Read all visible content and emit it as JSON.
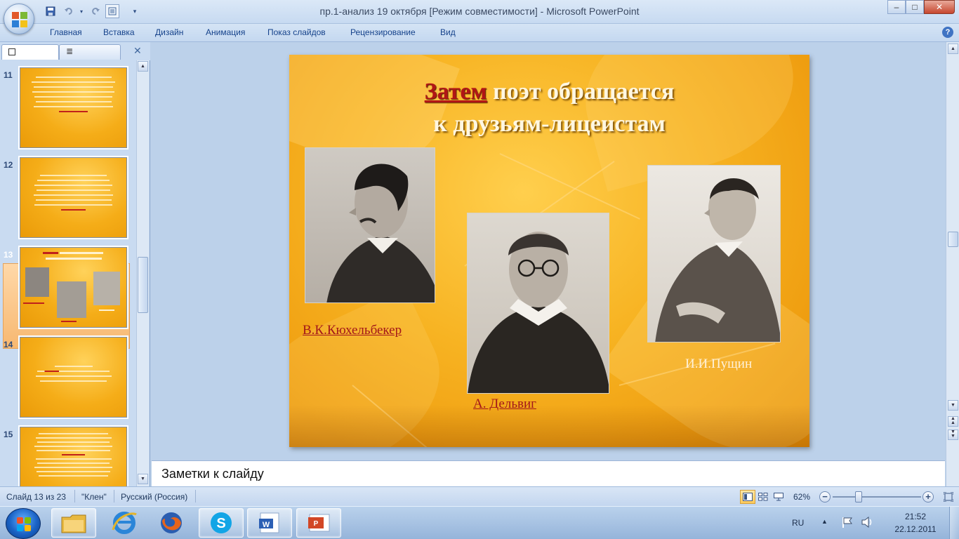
{
  "window": {
    "title": "пр.1-анализ 19 октября [Режим совместимости] - Microsoft PowerPoint",
    "minimize_glyph": "–",
    "maximize_glyph": "□",
    "close_glyph": "✕"
  },
  "ribbon": {
    "tabs": [
      "Главная",
      "Вставка",
      "Дизайн",
      "Анимация",
      "Показ слайдов",
      "Рецензирование",
      "Вид"
    ],
    "help_glyph": "?"
  },
  "slides_pane": {
    "close_glyph": "✕",
    "thumbnails": [
      {
        "number": "11"
      },
      {
        "number": "12"
      },
      {
        "number": "13",
        "selected": true
      },
      {
        "number": "14"
      },
      {
        "number": "15"
      }
    ]
  },
  "slide": {
    "title_highlight": "Затем",
    "title_rest_line1": " поэт обращается",
    "title_line2": "к друзьям-лицеистам",
    "captions": {
      "kuchelbecker": "В.К.Кюхельбекер",
      "delvig": "А. Дельвиг ",
      "pushchin": "И.И.Пущин"
    }
  },
  "notes": {
    "placeholder": "Заметки к слайду"
  },
  "status_bar": {
    "slide_counter": "Слайд 13 из 23",
    "theme": "\"Клен\"",
    "language": "Русский (Россия)",
    "zoom": "62%",
    "zoom_level_percent": 62,
    "zoom_out_glyph": "−",
    "zoom_in_glyph": "+"
  },
  "taskbar": {
    "apps": [
      {
        "name": "explorer-icon"
      },
      {
        "name": "internet-explorer-icon"
      },
      {
        "name": "firefox-icon"
      },
      {
        "name": "skype-icon"
      },
      {
        "name": "word-icon"
      },
      {
        "name": "powerpoint-icon"
      }
    ],
    "lang": "RU",
    "time": "21:52",
    "date": "22.12.2011"
  },
  "colors": {
    "slide_orange": "#f7b322",
    "accent_red": "#b11616",
    "ribbon_text": "#15428b",
    "selection": "#f7b871"
  }
}
